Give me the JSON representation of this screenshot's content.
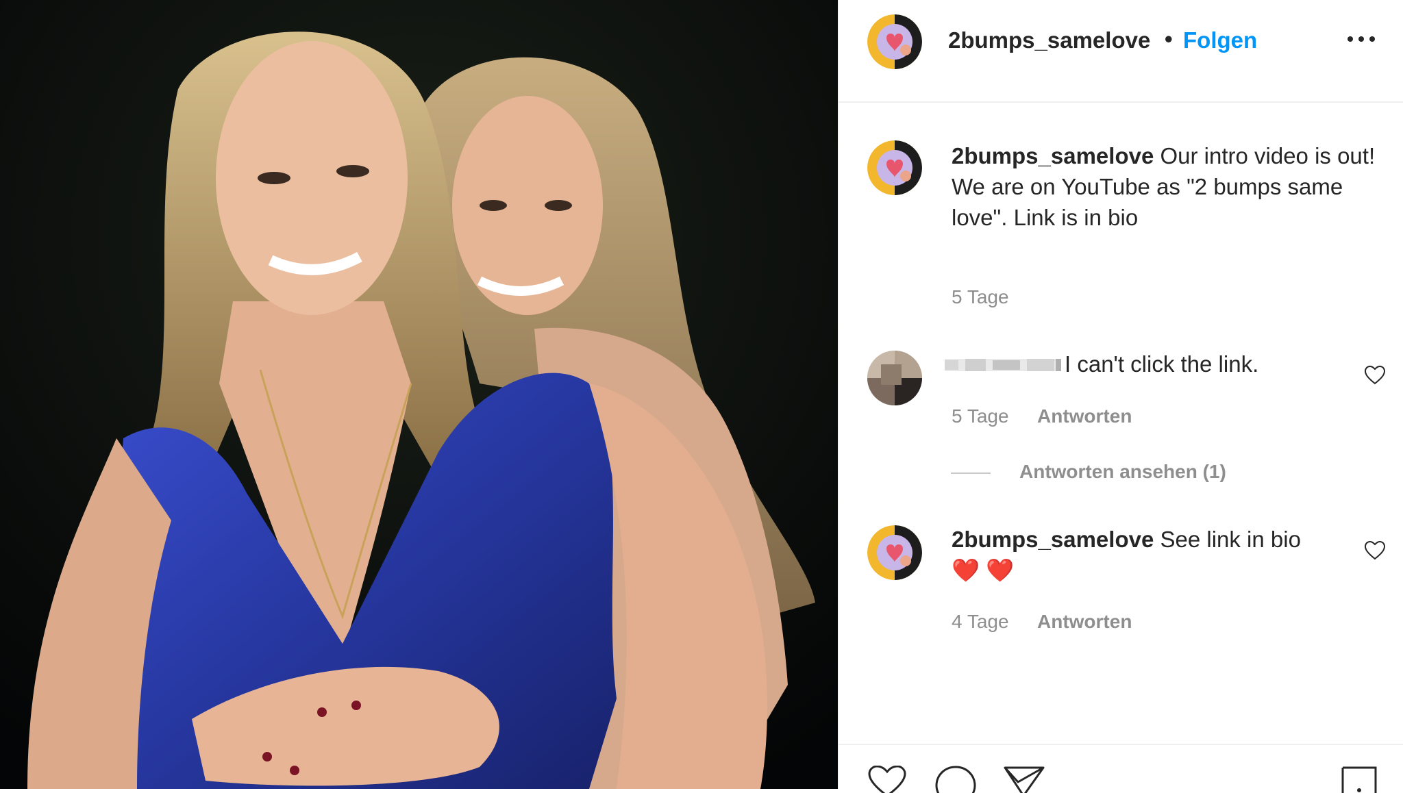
{
  "post": {
    "username": "2bumps_samelove",
    "separator": "•",
    "follow_label": "Folgen",
    "more_icon": "more-horizontal-icon"
  },
  "caption": {
    "username": "2bumps_samelove",
    "text_line1": " Our intro video is out!",
    "text_line2": "We are on YouTube as \"2 bumps same love\". Link is in bio",
    "time": "5 Tage"
  },
  "comments": [
    {
      "username_blurred": true,
      "text": "I can't click the link.",
      "time": "5 Tage",
      "reply_label": "Antworten",
      "view_replies_label": "Antworten ansehen (1)"
    },
    {
      "username": "2bumps_samelove",
      "text": " See link in bio",
      "emoji": "❤️ ❤️",
      "time": "4 Tage",
      "reply_label": "Antworten"
    }
  ],
  "actions": [
    "heart-icon",
    "comment-icon",
    "share-icon",
    "bookmark-icon"
  ],
  "colors": {
    "follow": "#0095f6",
    "text": "#262626",
    "muted": "#8e8e8e",
    "dress": "#2b3aa0"
  }
}
